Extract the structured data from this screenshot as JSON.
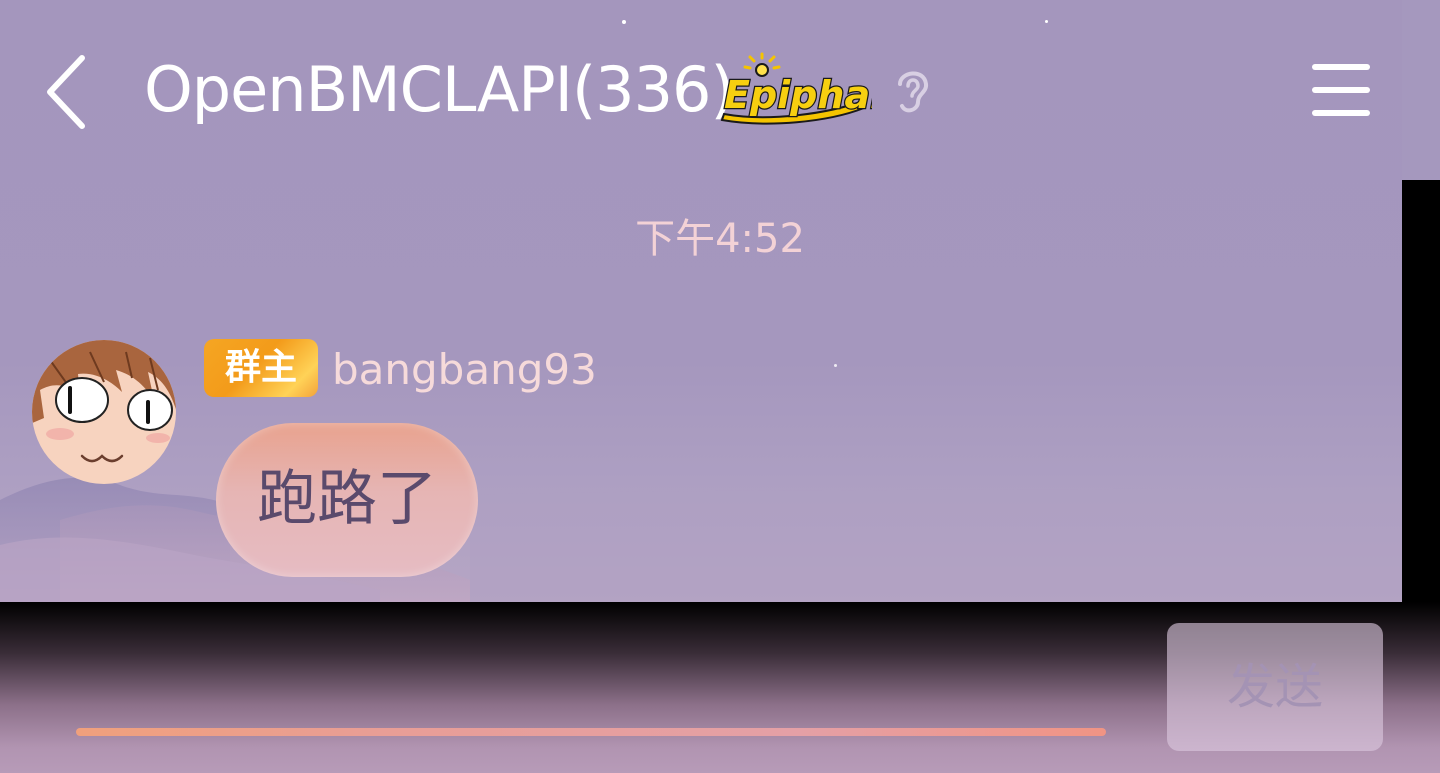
{
  "header": {
    "back_label": "back",
    "title": "OpenBMCLAPI(336)",
    "badge_text": "Epiphany",
    "ear_icon": "ear-icon",
    "menu_icon": "menu-icon"
  },
  "chat": {
    "timestamp": "下午4:52",
    "messages": [
      {
        "role_badge": "群主",
        "sender": "bangbang93",
        "text": "跑路了"
      }
    ]
  },
  "input": {
    "value": "",
    "placeholder": "",
    "send_label": "发送"
  },
  "colors": {
    "background": "#a598be",
    "timestamp_text": "#f3d2d6",
    "badge_gold": "#f5a623",
    "bubble": "#e6b5b4",
    "send_button_text": "#a493b4"
  }
}
